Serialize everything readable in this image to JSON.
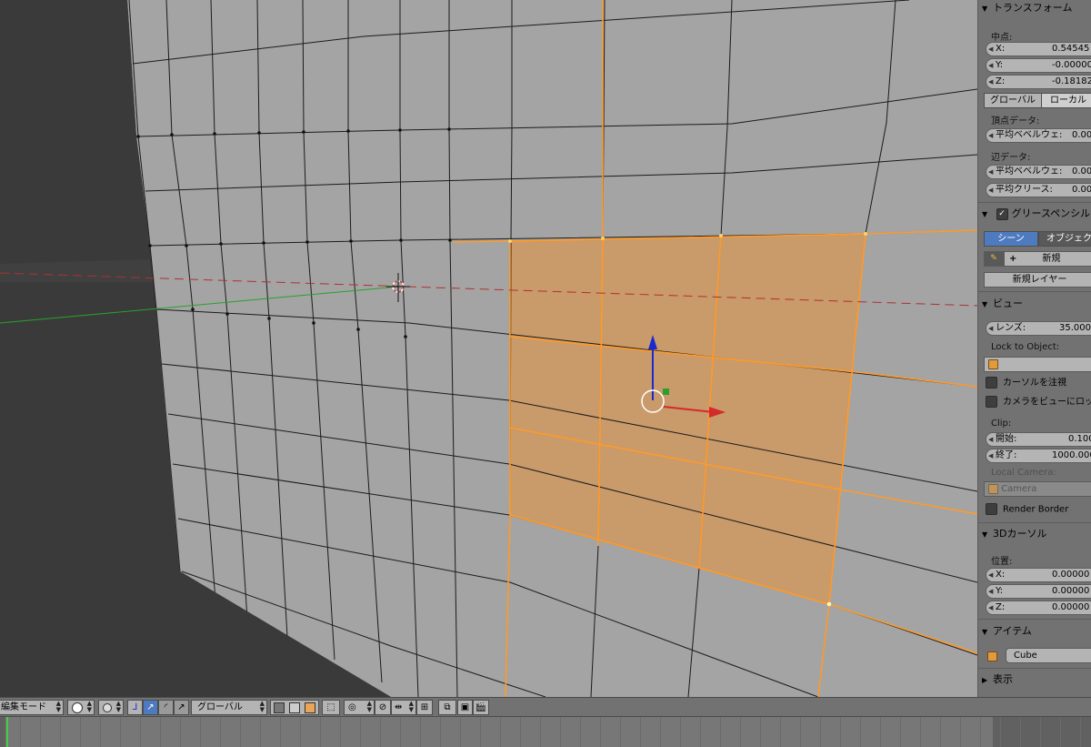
{
  "panel": {
    "transform": {
      "header": "トランスフォーム",
      "median_label": "中点:",
      "x": {
        "label": "X:",
        "value": "0.54545"
      },
      "y": {
        "label": "Y:",
        "value": "-0.00000"
      },
      "z": {
        "label": "Z:",
        "value": "-0.18182"
      },
      "global_label": "グローバル",
      "local_label": "ローカル",
      "vertex_data_label": "頂点データ:",
      "vertex_bevel": {
        "label": "平均ベベルウェ:",
        "value": "0.00"
      },
      "edge_data_label": "辺データ:",
      "edge_bevel": {
        "label": "平均ベベルウェ:",
        "value": "0.00"
      },
      "edge_crease": {
        "label": "平均クリース:",
        "value": "0.00"
      }
    },
    "grease_pencil": {
      "header": "グリースペンシル",
      "scene_label": "シーン",
      "object_label": "オブジェク",
      "new_label": "新規",
      "new_layer_label": "新規レイヤー"
    },
    "view": {
      "header": "ビュー",
      "lens": {
        "label": "レンズ:",
        "value": "35.000"
      },
      "lock_to_object_label": "Lock to Object:",
      "lock_cursor_label": "カーソルを注視",
      "lock_camera_label": "カメラをビューにロッ",
      "clip_label": "Clip:",
      "clip_start": {
        "label": "開始:",
        "value": "0.100"
      },
      "clip_end": {
        "label": "終了:",
        "value": "1000.000"
      },
      "local_camera_label": "Local Camera:",
      "camera_name": "Camera",
      "render_border_label": "Render Border"
    },
    "cursor3d": {
      "header": "3Dカーソル",
      "location_label": "位置:",
      "x": {
        "label": "X:",
        "value": "0.00000"
      },
      "y": {
        "label": "Y:",
        "value": "0.00000"
      },
      "z": {
        "label": "Z:",
        "value": "0.00000"
      }
    },
    "item": {
      "header": "アイテム",
      "name": "Cube"
    },
    "display": {
      "header": "表示"
    }
  },
  "header": {
    "mode_label": "編集モード",
    "orientation_label": "グローバル"
  },
  "colors": {
    "selection": "#ff9a2a",
    "face_fill": "#d99a5c",
    "x_axis": "#d42a2a",
    "y_axis": "#2aa02a",
    "z_axis": "#1a2ad0",
    "accent": "#4e7bc0"
  }
}
